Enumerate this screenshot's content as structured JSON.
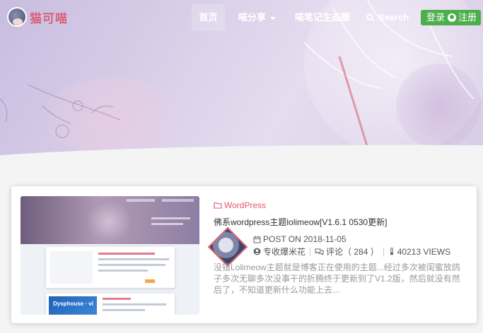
{
  "site": {
    "logo_text": "猫可喵"
  },
  "nav": {
    "home": "首页",
    "share": "喵分享",
    "notes": "喵笔记生态圈",
    "search": "Search",
    "login": "登录",
    "register": "注册"
  },
  "post": {
    "category": "WordPress",
    "title": "佛系wordpress主题lolimeow[V1.6.1 0530更新]",
    "date": "POST ON 2018-11-05",
    "author": "专收爆米花",
    "comments": "评论（ 284 ）",
    "views": "40213 VIEWS",
    "excerpt": "没错Lolimeow主题就是博客正在使用的主题...经过多次被闺蜜放鸽子多次无聊多次没事干的折腾终于更新到了V1.2版，然后就没有然后了，不知道更新什么功能上去...",
    "thumb_label": "Dysphouse · vi"
  },
  "colors": {
    "accent": "#e05a6e",
    "login_bg": "#4cae4c",
    "hero": "#d9cfe8"
  }
}
